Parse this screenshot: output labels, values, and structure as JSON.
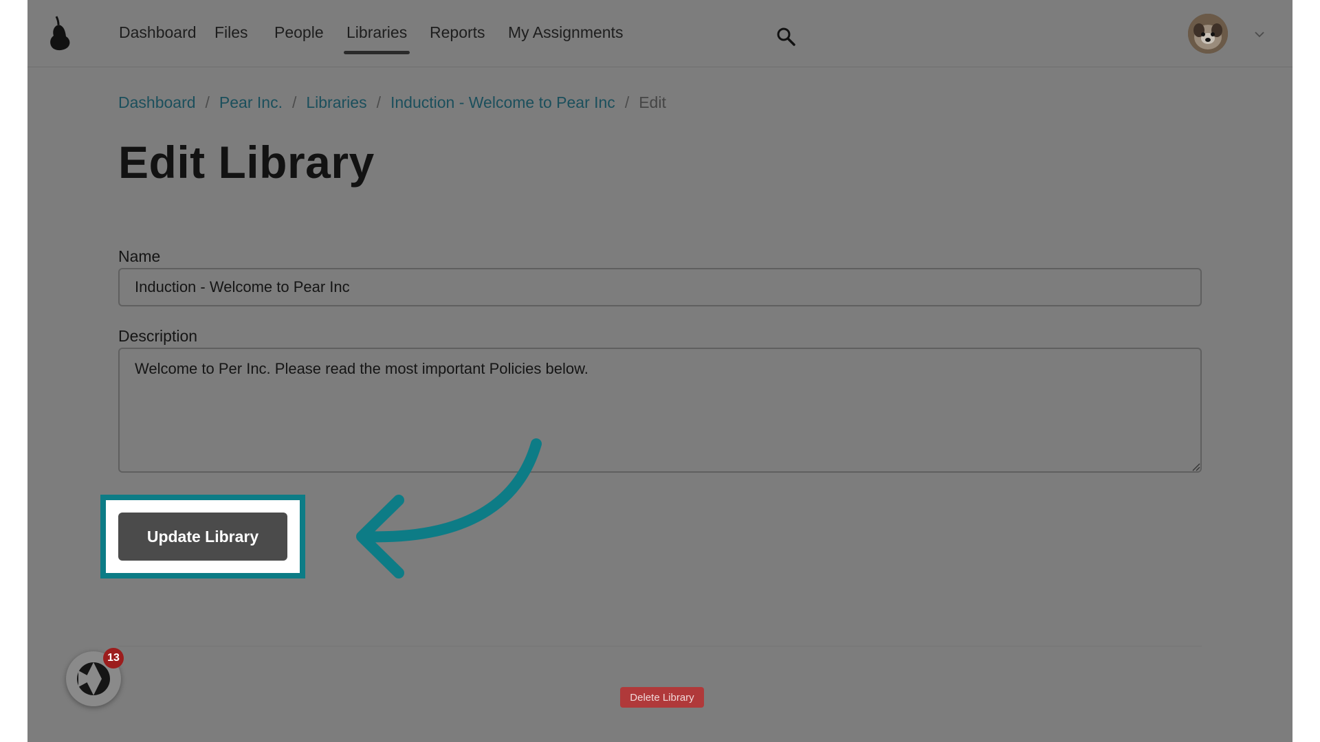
{
  "nav": {
    "items": [
      {
        "label": "Dashboard"
      },
      {
        "label": "Files"
      },
      {
        "label": "People"
      },
      {
        "label": "Libraries",
        "active": true
      },
      {
        "label": "Reports"
      },
      {
        "label": "My Assignments"
      }
    ],
    "search_icon": "search-icon",
    "menu_icon": "chevron-down-icon"
  },
  "breadcrumb": {
    "items": [
      "Dashboard",
      "Pear Inc.",
      "Libraries",
      "Induction - Welcome to Pear Inc",
      "Edit"
    ],
    "separator": "/"
  },
  "page": {
    "title": "Edit Library"
  },
  "form": {
    "name_label": "Name",
    "name_value": "Induction - Welcome to Pear Inc",
    "description_label": "Description",
    "description_value": "Welcome to Per Inc. Please read the most important Policies below.",
    "update_label": "Update Library",
    "delete_label": "Delete Library"
  },
  "widget": {
    "badge_count": "13"
  },
  "colors": {
    "accent": "#0d7c86",
    "overlay": "#7d7d7d",
    "danger": "#b0393a"
  }
}
